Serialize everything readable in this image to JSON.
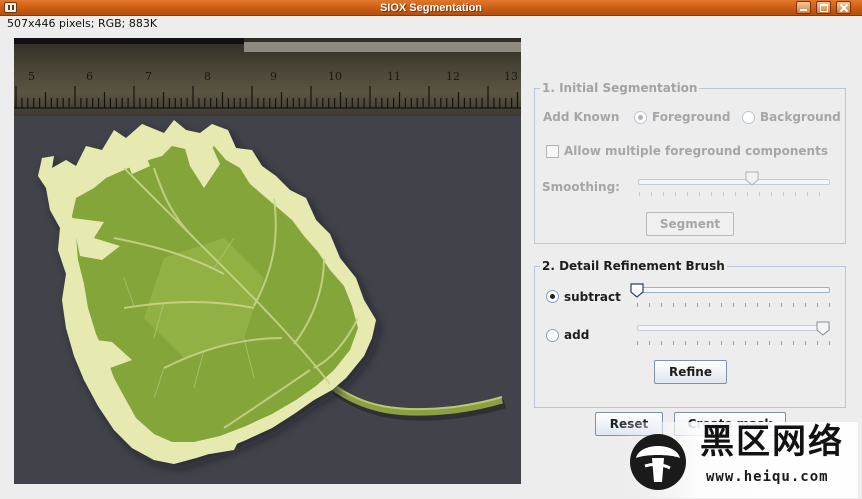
{
  "window": {
    "title": "SIOX Segmentation",
    "app_icon": "window-menu-icon"
  },
  "image_info": "507x446 pixels; RGB; 883K",
  "ruler_numbers": [
    "5",
    "6",
    "7",
    "8",
    "9",
    "10",
    "11",
    "12",
    "13"
  ],
  "initial_segmentation": {
    "legend": "1. Initial Segmentation",
    "add_known_label": "Add Known",
    "foreground_label": "Foreground",
    "background_label": "Background",
    "selected": "foreground",
    "allow_multiple_label": "Allow multiple foreground components",
    "allow_multiple_checked": false,
    "smoothing_label": "Smoothing:",
    "smoothing_level": 0.6,
    "segment_button": "Segment",
    "enabled": false
  },
  "detail_refinement": {
    "legend": "2. Detail Refinement Brush",
    "subtract_label": "subtract",
    "add_label": "add",
    "selected": "subtract",
    "subtract_level": 0.0,
    "add_level": 1.0,
    "refine_button": "Refine"
  },
  "actions": {
    "reset_button": "Reset",
    "create_mask_button": "Create mask"
  },
  "watermark": {
    "text": "黑区网络",
    "url": "www.heiqu.com"
  },
  "colors": {
    "titlebar": "#c85a12",
    "group_border": "#b9c7d8",
    "leaf_green": "#86a63a",
    "leaf_cream": "#e9ebb4",
    "background_gray": "#42434a"
  }
}
